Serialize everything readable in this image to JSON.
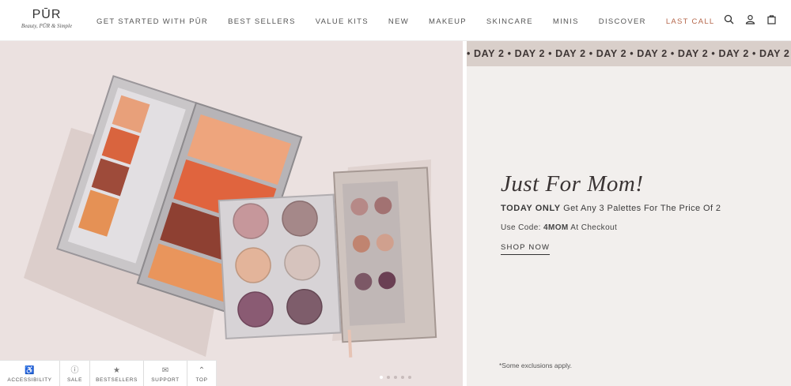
{
  "header": {
    "logo_mark": "PŪR",
    "logo_tagline": "Beauty, PŪR & Simple",
    "nav": [
      {
        "label": "GET STARTED WITH PŪR"
      },
      {
        "label": "BEST SELLERS"
      },
      {
        "label": "VALUE KITS"
      },
      {
        "label": "NEW"
      },
      {
        "label": "MAKEUP"
      },
      {
        "label": "SKINCARE"
      },
      {
        "label": "MINIS"
      },
      {
        "label": "DISCOVER"
      },
      {
        "label": "LAST CALL"
      }
    ],
    "icons": [
      "search-icon",
      "account-icon",
      "bag-icon"
    ]
  },
  "marquee": {
    "text": "• DAY 2 • DAY 2 • DAY 2 • DAY 2 • DAY 2 • DAY 2 • DAY 2 • DAY 2 •"
  },
  "promo": {
    "title": "Just For Mom!",
    "offer_strong": "TODAY ONLY",
    "offer_text": "Get Any 3 Palettes For The Price Of 2",
    "code_prefix": "Use Code:",
    "code": "4MOM",
    "code_suffix": "At Checkout",
    "cta": "SHOP NOW",
    "exclusions": "*Some exclusions apply."
  },
  "carousel": {
    "slide_count": 5,
    "active_index": 0
  },
  "toolbar": {
    "items": [
      {
        "label": "ACCESSIBILITY",
        "icon": "accessibility-icon"
      },
      {
        "label": "SALE",
        "icon": "sale-icon"
      },
      {
        "label": "BESTSELLERS",
        "icon": "star-icon"
      },
      {
        "label": "SUPPORT",
        "icon": "chat-icon"
      },
      {
        "label": "TOP",
        "icon": "chevron-up-icon"
      }
    ]
  },
  "colors": {
    "accent": "#b5674b",
    "hero_bg": "#ebe1e0",
    "promo_bg": "#f2efed",
    "marquee_bg": "#d9cfca"
  }
}
